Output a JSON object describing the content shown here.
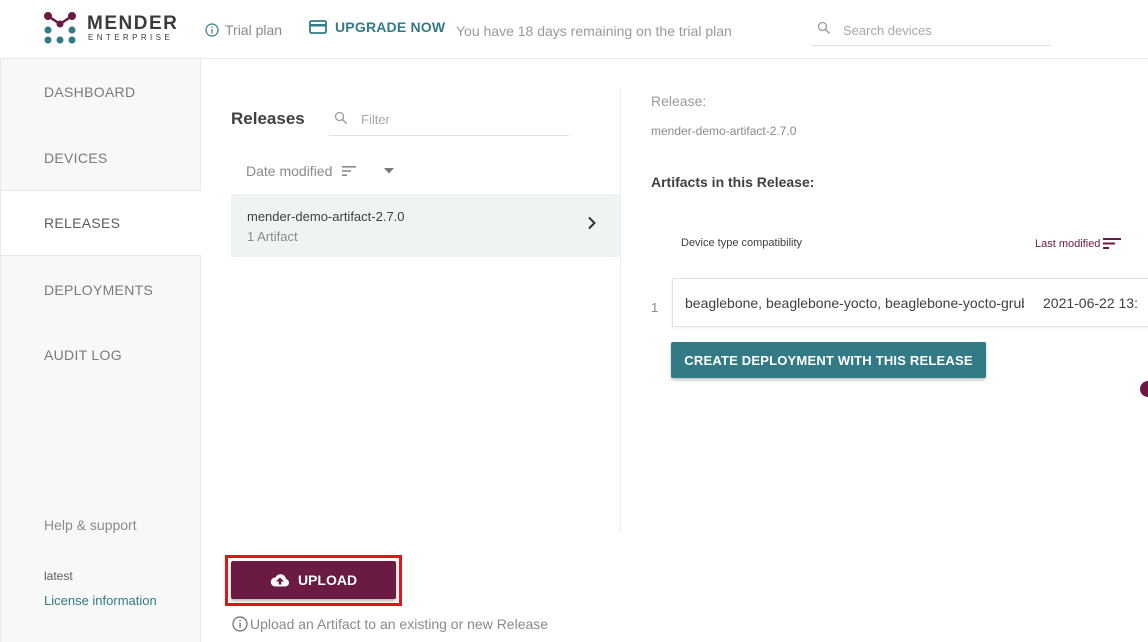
{
  "header": {
    "logo_title": "MENDER",
    "logo_subtitle": "ENTERPRISE",
    "trial_label": "Trial plan",
    "upgrade_label": "UPGRADE NOW",
    "trial_remaining": "You have 18 days remaining on the trial plan",
    "search_placeholder": "Search devices"
  },
  "sidebar": {
    "items": [
      {
        "label": "DASHBOARD"
      },
      {
        "label": "DEVICES"
      },
      {
        "label": "RELEASES",
        "active": true
      },
      {
        "label": "DEPLOYMENTS"
      },
      {
        "label": "AUDIT LOG"
      }
    ],
    "help": "Help & support",
    "version": "latest",
    "license": "License information"
  },
  "releases": {
    "title": "Releases",
    "filter_placeholder": "Filter",
    "sort_label": "Date modified",
    "list": [
      {
        "name": "mender-demo-artifact-2.7.0",
        "count": "1 Artifact"
      }
    ]
  },
  "details": {
    "release_label": "Release:",
    "release_name": "mender-demo-artifact-2.7.0",
    "artifacts_title": "Artifacts in this Release:",
    "columns": {
      "device": "Device type compatibility",
      "modified": "Last modified"
    },
    "artifacts": [
      {
        "index": "1",
        "device": "beaglebone, beaglebone-yocto, beaglebone-yocto-grub",
        "modified": "2021-06-22 13:"
      }
    ],
    "create_label": "CREATE DEPLOYMENT WITH THIS RELEASE"
  },
  "upload": {
    "label": "UPLOAD",
    "hint": "Upload an Artifact to an existing or new Release"
  },
  "colors": {
    "brand": "#6b1a44",
    "accent": "#337a87",
    "highlight": "#e0161b"
  }
}
